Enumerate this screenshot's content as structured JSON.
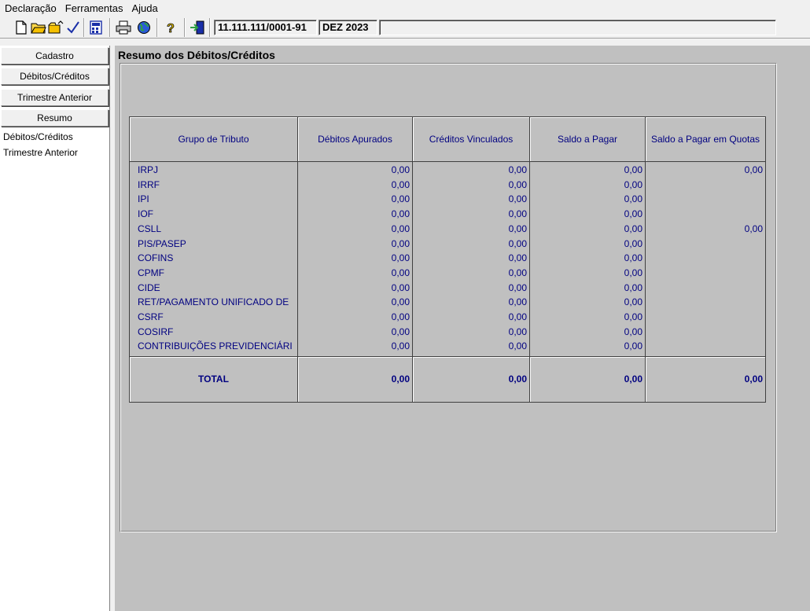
{
  "menu": [
    "Declaração",
    "Ferramentas",
    "Ajuda"
  ],
  "toolbar": {
    "icons": [
      "new-document-icon",
      "open-folder-icon",
      "open-file-icon",
      "check-icon",
      "calculator-icon",
      "printer-icon",
      "globe-icon",
      "help-icon",
      "exit-icon"
    ],
    "cnpj": "11.111.111/0001-91",
    "period": "DEZ 2023",
    "extra": ""
  },
  "sidebar": {
    "buttons": [
      "Cadastro",
      "Débitos/Créditos",
      "Trimestre Anterior",
      "Resumo"
    ],
    "subitems": [
      "Débitos/Créditos",
      "Trimestre Anterior"
    ]
  },
  "main": {
    "title": "Resumo dos Débitos/Créditos",
    "table": {
      "headers": [
        "Grupo de Tributo",
        "Débitos Apurados",
        "Créditos Vinculados",
        "Saldo a Pagar",
        "Saldo a Pagar em Quotas"
      ],
      "rows": [
        {
          "name": "IRPJ",
          "debitos": "0,00",
          "creditos": "0,00",
          "saldo": "0,00",
          "quotas": "0,00"
        },
        {
          "name": "IRRF",
          "debitos": "0,00",
          "creditos": "0,00",
          "saldo": "0,00",
          "quotas": ""
        },
        {
          "name": "IPI",
          "debitos": "0,00",
          "creditos": "0,00",
          "saldo": "0,00",
          "quotas": ""
        },
        {
          "name": "IOF",
          "debitos": "0,00",
          "creditos": "0,00",
          "saldo": "0,00",
          "quotas": ""
        },
        {
          "name": "CSLL",
          "debitos": "0,00",
          "creditos": "0,00",
          "saldo": "0,00",
          "quotas": "0,00"
        },
        {
          "name": "PIS/PASEP",
          "debitos": "0,00",
          "creditos": "0,00",
          "saldo": "0,00",
          "quotas": ""
        },
        {
          "name": "COFINS",
          "debitos": "0,00",
          "creditos": "0,00",
          "saldo": "0,00",
          "quotas": ""
        },
        {
          "name": "CPMF",
          "debitos": "0,00",
          "creditos": "0,00",
          "saldo": "0,00",
          "quotas": ""
        },
        {
          "name": "CIDE",
          "debitos": "0,00",
          "creditos": "0,00",
          "saldo": "0,00",
          "quotas": ""
        },
        {
          "name": "RET/PAGAMENTO UNIFICADO DE",
          "debitos": "0,00",
          "creditos": "0,00",
          "saldo": "0,00",
          "quotas": ""
        },
        {
          "name": "CSRF",
          "debitos": "0,00",
          "creditos": "0,00",
          "saldo": "0,00",
          "quotas": ""
        },
        {
          "name": "COSIRF",
          "debitos": "0,00",
          "creditos": "0,00",
          "saldo": "0,00",
          "quotas": ""
        },
        {
          "name": "CONTRIBUIÇÕES PREVIDENCIÁRI",
          "debitos": "0,00",
          "creditos": "0,00",
          "saldo": "0,00",
          "quotas": ""
        }
      ],
      "total": {
        "label": "TOTAL",
        "debitos": "0,00",
        "creditos": "0,00",
        "saldo": "0,00",
        "quotas": "0,00"
      }
    }
  }
}
